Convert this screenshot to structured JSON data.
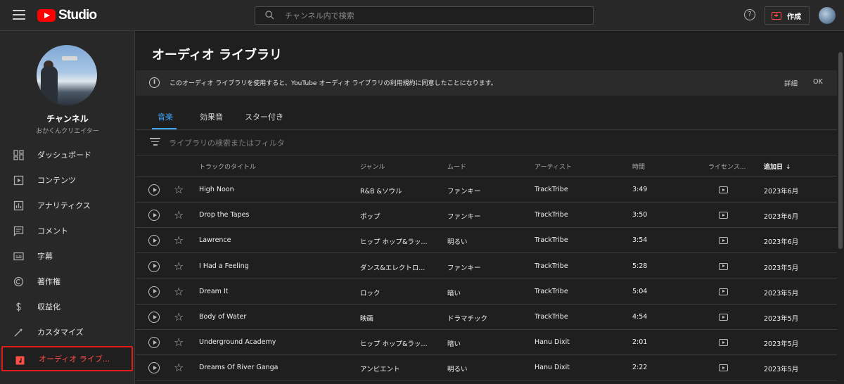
{
  "header": {
    "logo_text": "Studio",
    "search_placeholder": "チャンネル内で検索",
    "help_glyph": "?",
    "create_label": "作成"
  },
  "sidebar": {
    "channel_title": "チャンネル",
    "channel_subtitle": "おかくんクリエイター",
    "items": [
      {
        "label": "ダッシュボード",
        "icon": "dashboard-icon"
      },
      {
        "label": "コンテンツ",
        "icon": "content-icon"
      },
      {
        "label": "アナリティクス",
        "icon": "analytics-icon"
      },
      {
        "label": "コメント",
        "icon": "comments-icon"
      },
      {
        "label": "字幕",
        "icon": "subtitles-icon"
      },
      {
        "label": "著作権",
        "icon": "copyright-icon"
      },
      {
        "label": "収益化",
        "icon": "monetization-icon"
      },
      {
        "label": "カスタマイズ",
        "icon": "customize-icon"
      },
      {
        "label": "オーディオ ライブ...",
        "icon": "audio-library-icon",
        "active": true
      }
    ]
  },
  "main": {
    "title": "オーディオ ライブラリ",
    "notice": {
      "info_glyph": "i",
      "text": "このオーディオ ライブラリを使用すると、YouTube オーディオ ライブラリの利用規約に同意したことになります。",
      "details": "詳細",
      "ok": "OK"
    },
    "tabs": [
      "音楽",
      "効果音",
      "スター付き"
    ],
    "filter_placeholder": "ライブラリの検索またはフィルタ",
    "columns": {
      "title": "トラックのタイトル",
      "genre": "ジャンル",
      "mood": "ムード",
      "artist": "アーティスト",
      "duration": "時間",
      "license": "ライセンス...",
      "added": "追加日",
      "sort_arrow": "↓"
    },
    "tracks": [
      {
        "title": "High Noon",
        "genre": "R&B &ソウル",
        "mood": "ファンキー",
        "artist": "TrackTribe",
        "duration": "3:49",
        "added": "2023年6月"
      },
      {
        "title": "Drop the Tapes",
        "genre": "ポップ",
        "mood": "ファンキー",
        "artist": "TrackTribe",
        "duration": "3:50",
        "added": "2023年6月"
      },
      {
        "title": "Lawrence",
        "genre": "ヒップ ホップ&ラッ...",
        "mood": "明るい",
        "artist": "TrackTribe",
        "duration": "3:54",
        "added": "2023年6月"
      },
      {
        "title": "I Had a Feeling",
        "genre": "ダンス&エレクトロ...",
        "mood": "ファンキー",
        "artist": "TrackTribe",
        "duration": "5:28",
        "added": "2023年5月"
      },
      {
        "title": "Dream It",
        "genre": "ロック",
        "mood": "暗い",
        "artist": "TrackTribe",
        "duration": "5:04",
        "added": "2023年5月"
      },
      {
        "title": "Body of Water",
        "genre": "映画",
        "mood": "ドラマチック",
        "artist": "TrackTribe",
        "duration": "4:54",
        "added": "2023年5月"
      },
      {
        "title": "Underground Academy",
        "genre": "ヒップ ホップ&ラッ...",
        "mood": "暗い",
        "artist": "Hanu Dixit",
        "duration": "2:01",
        "added": "2023年5月"
      },
      {
        "title": "Dreams Of River Ganga",
        "genre": "アンビエント",
        "mood": "明るい",
        "artist": "Hanu Dixit",
        "duration": "2:22",
        "added": "2023年5月"
      }
    ]
  },
  "colors": {
    "accent_blue": "#3ea6ff",
    "brand_red": "#ff0000",
    "active_red": "#ff4e45",
    "highlight_border": "#e41b1b",
    "background": "#1f1f1f",
    "panel": "#282828"
  }
}
